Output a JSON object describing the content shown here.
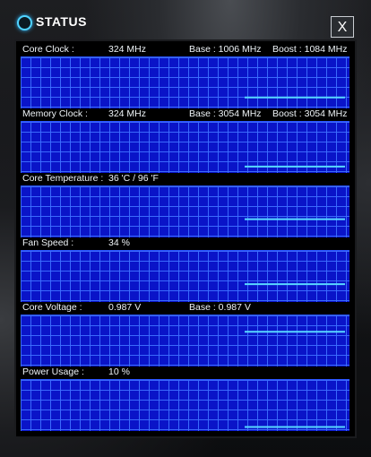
{
  "window": {
    "title": "STATUS",
    "close_label": "X"
  },
  "sections": [
    {
      "label": "Core Clock :",
      "value": "324 MHz",
      "base": "Base : 1006 MHz",
      "boost": "Boost : 1084 MHz",
      "level": 0.2,
      "noisy": false
    },
    {
      "label": "Memory Clock :",
      "value": "324 MHz",
      "base": "Base : 3054 MHz",
      "boost": "Boost : 3054 MHz",
      "level": 0.1,
      "noisy": false
    },
    {
      "label": "Core Temperature :",
      "value": "36 'C / 96 'F",
      "base": "",
      "boost": "",
      "level": 0.36,
      "noisy": false
    },
    {
      "label": "Fan Speed :",
      "value": "34 %",
      "base": "",
      "boost": "",
      "level": 0.34,
      "noisy": true
    },
    {
      "label": "Core Voltage :",
      "value": "0.987 V",
      "base": "Base : 0.987 V",
      "boost": "",
      "level": 0.72,
      "noisy": false
    },
    {
      "label": "Power Usage :",
      "value": "10 %",
      "base": "",
      "boost": "",
      "level": 0.05,
      "noisy": false
    }
  ],
  "colors": {
    "graph_bg": "#0a14c8",
    "grid": "#3c6eff",
    "trace": "#58d8ff",
    "accent": "#4fd3ff"
  }
}
